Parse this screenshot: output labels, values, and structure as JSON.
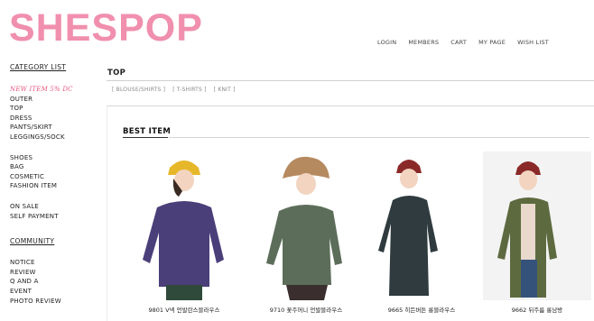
{
  "brand": {
    "logo": "SHESPOP",
    "accent": "#f08fae"
  },
  "topnav": [
    "LOGIN",
    "MEMBERS",
    "CART",
    "MY PAGE",
    "WISH LIST"
  ],
  "sidebar": {
    "category_heading": "CATEGORY LIST",
    "groups": [
      [
        "NEW ITEM 5% DC",
        "OUTER",
        "TOP",
        "DRESS",
        "PANTS/SKIRT",
        "LEGGINGS/SOCK"
      ],
      [
        "SHOES",
        "BAG",
        "COSMETIC",
        "FASHION ITEM"
      ],
      [
        "ON SALE",
        "SELF PAYMENT"
      ]
    ],
    "community_heading": "COMMUNITY",
    "community_items": [
      "NOTICE",
      "REVIEW",
      "Q AND A",
      "EVENT",
      "PHOTO REVIEW"
    ]
  },
  "main": {
    "section_title": "TOP",
    "subcategories": [
      "[ BLOUSE/SHIRTS ]",
      "[ T-SHIRTS ]",
      "[ KNIT ]"
    ],
    "best_title": "BEST ITEM",
    "products": [
      {
        "caption": "9801 V넥 언발란스블라우스",
        "hat": "#e7b72a",
        "top": "#4b3f7a",
        "bottom": "#2f4a3a",
        "skin": "#f2d4c0",
        "photo_bg": "white"
      },
      {
        "caption": "9710 꽃주머니 언발블라우스",
        "hat": "#b58a5f",
        "top": "#5c6e5a",
        "bottom": "#3a2e2e",
        "skin": "#f2d4c0",
        "photo_bg": "white"
      },
      {
        "caption": "9665 히든버튼 롱블라우스",
        "hat": "#8a2a28",
        "top": "#2f3b3e",
        "bottom": "#2f3b3e",
        "skin": "#f2d4c0",
        "photo_bg": "white"
      },
      {
        "caption": "9662 뒤주름 롱남방",
        "hat": "#8a2a28",
        "top": "#5d6a3f",
        "bottom": "#35537a",
        "skin": "#f2d4c0",
        "photo_bg": "grey"
      }
    ]
  }
}
